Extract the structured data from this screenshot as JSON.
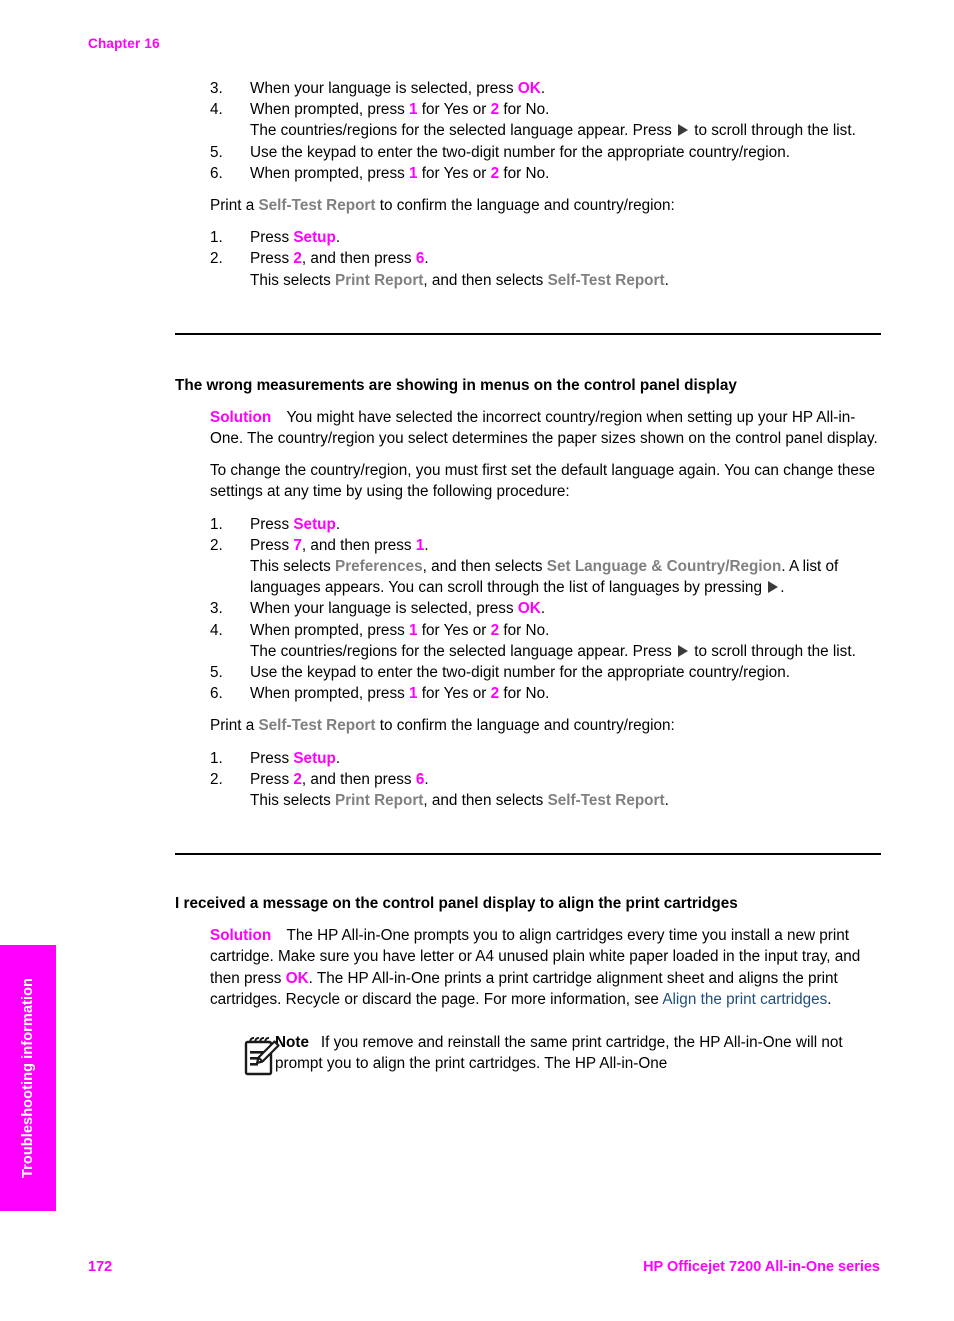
{
  "header": {
    "chapter": "Chapter 16"
  },
  "side_tab": {
    "label": "Troubleshooting information",
    "background": "#ff00ff",
    "text_color": "#ffffff"
  },
  "colors": {
    "key_highlight": "#ff00ff",
    "ui_term": "#808080",
    "hyperlink": "#1f4e79",
    "body_text": "#000000"
  },
  "top_steps": {
    "items": [
      {
        "num": "3.",
        "text_parts": [
          {
            "t": "When your language is selected, press ",
            "style": "plain"
          },
          {
            "t": "OK",
            "style": "key"
          },
          {
            "t": ".",
            "style": "plain"
          }
        ]
      },
      {
        "num": "4.",
        "text_parts": [
          {
            "t": "When prompted, press ",
            "style": "plain"
          },
          {
            "t": "1",
            "style": "key"
          },
          {
            "t": " for Yes or ",
            "style": "plain"
          },
          {
            "t": "2",
            "style": "key"
          },
          {
            "t": " for No.",
            "style": "plain"
          }
        ],
        "sub_parts": [
          {
            "t": "The countries/regions for the selected language appear. Press ",
            "style": "plain"
          },
          {
            "t": "",
            "style": "arrow"
          },
          {
            "t": " to scroll through the list.",
            "style": "plain"
          }
        ]
      },
      {
        "num": "5.",
        "text_parts": [
          {
            "t": "Use the keypad to enter the two-digit number for the appropriate country/region.",
            "style": "plain"
          }
        ]
      },
      {
        "num": "6.",
        "text_parts": [
          {
            "t": "When prompted, press ",
            "style": "plain"
          },
          {
            "t": "1",
            "style": "key"
          },
          {
            "t": " for Yes or ",
            "style": "plain"
          },
          {
            "t": "2",
            "style": "key"
          },
          {
            "t": " for No.",
            "style": "plain"
          }
        ]
      }
    ],
    "lead_in": [
      {
        "t": "Print a ",
        "style": "plain"
      },
      {
        "t": "Self-Test Report",
        "style": "uiterm"
      },
      {
        "t": " to confirm the language and country/region:",
        "style": "plain"
      }
    ],
    "report_steps": [
      {
        "num": "1.",
        "text_parts": [
          {
            "t": "Press ",
            "style": "plain"
          },
          {
            "t": "Setup",
            "style": "key"
          },
          {
            "t": ".",
            "style": "plain"
          }
        ]
      },
      {
        "num": "2.",
        "text_parts": [
          {
            "t": "Press ",
            "style": "plain"
          },
          {
            "t": "2",
            "style": "key"
          },
          {
            "t": ", and then press ",
            "style": "plain"
          },
          {
            "t": "6",
            "style": "key"
          },
          {
            "t": ".",
            "style": "plain"
          }
        ],
        "sub_parts": [
          {
            "t": "This selects ",
            "style": "plain"
          },
          {
            "t": "Print Report",
            "style": "uiterm"
          },
          {
            "t": ", and then selects ",
            "style": "plain"
          },
          {
            "t": "Self-Test Report",
            "style": "uiterm"
          },
          {
            "t": ".",
            "style": "plain"
          }
        ]
      }
    ]
  },
  "section_measurements": {
    "heading": "The wrong measurements are showing in menus on the control panel display",
    "solution_label": "Solution",
    "solution_parts": [
      {
        "t": "Solution",
        "style": "key"
      },
      {
        "t": " You might have selected the incorrect country/region when setting up your HP All-in-One. The country/region you select determines the paper sizes shown on the control panel display.",
        "style": "plain"
      }
    ],
    "paragraph2": "To change the country/region, you must first set the default language again. You can change these settings at any time by using the following procedure:",
    "steps": [
      {
        "num": "1.",
        "text_parts": [
          {
            "t": "Press ",
            "style": "plain"
          },
          {
            "t": "Setup",
            "style": "key"
          },
          {
            "t": ".",
            "style": "plain"
          }
        ]
      },
      {
        "num": "2.",
        "text_parts": [
          {
            "t": "Press ",
            "style": "plain"
          },
          {
            "t": "7",
            "style": "key"
          },
          {
            "t": ", and then press ",
            "style": "plain"
          },
          {
            "t": "1",
            "style": "key"
          },
          {
            "t": ".",
            "style": "plain"
          }
        ],
        "sub_parts": [
          {
            "t": "This selects ",
            "style": "plain"
          },
          {
            "t": "Preferences",
            "style": "uiterm"
          },
          {
            "t": ", and then selects ",
            "style": "plain"
          },
          {
            "t": "Set Language & Country/Region",
            "style": "uiterm"
          },
          {
            "t": ". A list of languages appears. You can scroll through the list of languages by pressing ",
            "style": "plain"
          },
          {
            "t": "",
            "style": "arrow"
          },
          {
            "t": ".",
            "style": "plain"
          }
        ]
      },
      {
        "num": "3.",
        "text_parts": [
          {
            "t": "When your language is selected, press ",
            "style": "plain"
          },
          {
            "t": "OK",
            "style": "key"
          },
          {
            "t": ".",
            "style": "plain"
          }
        ]
      },
      {
        "num": "4.",
        "text_parts": [
          {
            "t": "When prompted, press ",
            "style": "plain"
          },
          {
            "t": "1",
            "style": "key"
          },
          {
            "t": " for Yes or ",
            "style": "plain"
          },
          {
            "t": "2",
            "style": "key"
          },
          {
            "t": " for No.",
            "style": "plain"
          }
        ],
        "sub_parts": [
          {
            "t": "The countries/regions for the selected language appear. Press ",
            "style": "plain"
          },
          {
            "t": "",
            "style": "arrow"
          },
          {
            "t": " to scroll through the list.",
            "style": "plain"
          }
        ]
      },
      {
        "num": "5.",
        "text_parts": [
          {
            "t": "Use the keypad to enter the two-digit number for the appropriate country/region.",
            "style": "plain"
          }
        ]
      },
      {
        "num": "6.",
        "text_parts": [
          {
            "t": "When prompted, press ",
            "style": "plain"
          },
          {
            "t": "1",
            "style": "key"
          },
          {
            "t": " for Yes or ",
            "style": "plain"
          },
          {
            "t": "2",
            "style": "key"
          },
          {
            "t": " for No.",
            "style": "plain"
          }
        ]
      }
    ],
    "lead_in": [
      {
        "t": "Print a ",
        "style": "plain"
      },
      {
        "t": "Self-Test Report",
        "style": "uiterm"
      },
      {
        "t": " to confirm the language and country/region:",
        "style": "plain"
      }
    ],
    "report_steps": [
      {
        "num": "1.",
        "text_parts": [
          {
            "t": "Press ",
            "style": "plain"
          },
          {
            "t": "Setup",
            "style": "key"
          },
          {
            "t": ".",
            "style": "plain"
          }
        ]
      },
      {
        "num": "2.",
        "text_parts": [
          {
            "t": "Press ",
            "style": "plain"
          },
          {
            "t": "2",
            "style": "key"
          },
          {
            "t": ", and then press ",
            "style": "plain"
          },
          {
            "t": "6",
            "style": "key"
          },
          {
            "t": ".",
            "style": "plain"
          }
        ],
        "sub_parts": [
          {
            "t": "This selects ",
            "style": "plain"
          },
          {
            "t": "Print Report",
            "style": "uiterm"
          },
          {
            "t": ", and then selects ",
            "style": "plain"
          },
          {
            "t": "Self-Test Report",
            "style": "uiterm"
          },
          {
            "t": ".",
            "style": "plain"
          }
        ]
      }
    ]
  },
  "section_cartridges": {
    "heading": "I received a message on the control panel display to align the print cartridges",
    "solution_parts": [
      {
        "t": "Solution",
        "style": "key"
      },
      {
        "t": " The HP All-in-One prompts you to align cartridges every time you install a new print cartridge. Make sure you have letter or A4 unused plain white paper loaded in the input tray, and then press ",
        "style": "plain"
      },
      {
        "t": "OK",
        "style": "key"
      },
      {
        "t": ". The HP All-in-One prints a print cartridge alignment sheet and aligns the print cartridges. Recycle or discard the page. For more information, see ",
        "style": "plain"
      },
      {
        "t": "Align the print cartridges",
        "style": "link"
      },
      {
        "t": ".",
        "style": "plain"
      }
    ],
    "note": {
      "icon": "note-pencil-icon",
      "label": "Note",
      "parts": [
        {
          "t": "Note",
          "style": "notelabel"
        },
        {
          "t": "  If you remove and reinstall the same print cartridge, the HP All-in-One will not prompt you to align the print cartridges. The HP All-in-One",
          "style": "plain"
        }
      ]
    }
  },
  "footer": {
    "page_number": "172",
    "product": "HP Officejet 7200 All-in-One series"
  }
}
